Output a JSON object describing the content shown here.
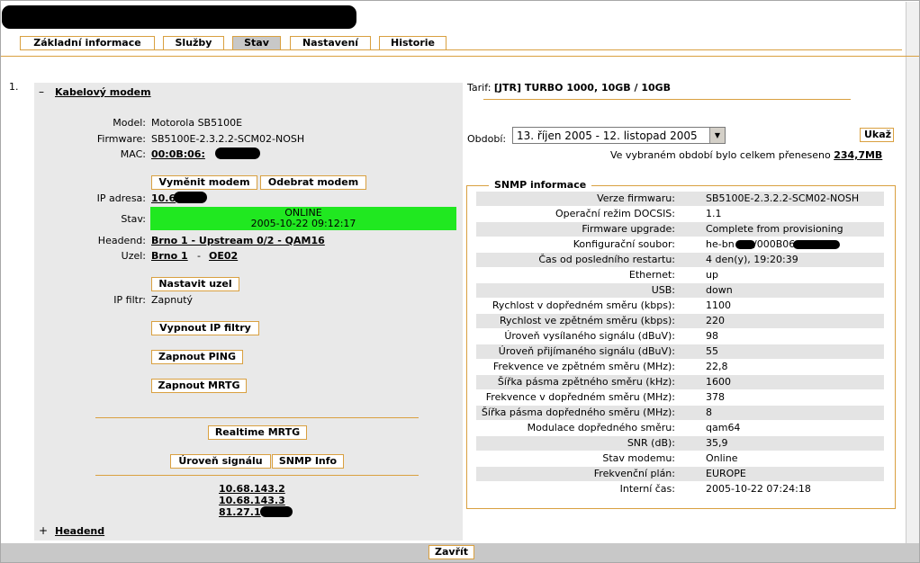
{
  "tabs": [
    {
      "label": "Základní informace"
    },
    {
      "label": "Služby"
    },
    {
      "label": "Stav"
    },
    {
      "label": "Nastavení"
    },
    {
      "label": "Historie"
    }
  ],
  "list_number": "1.",
  "modem_section": {
    "toggle": "–",
    "title": "Kabelový modem",
    "model_label": "Model:",
    "model_value": "Motorola SB5100E",
    "firmware_label": "Firmware:",
    "firmware_value": "SB5100E-2.3.2.2-SCM02-NOSH",
    "mac_label": "MAC:",
    "mac_value": "00:0B:06:",
    "replace_modem": "Vyměnit modem",
    "remove_modem": "Odebrat modem",
    "ip_label": "IP adresa:",
    "ip_value": "10.6",
    "state_label": "Stav:",
    "state_value": "ONLINE",
    "state_time": "2005-10-22 09:12:17",
    "headend_label": "Headend:",
    "headend_value": "Brno 1 - Upstream 0/2 - QAM16",
    "node_label": "Uzel:",
    "node_value": "Brno 1",
    "node_sep": "-",
    "node_code": "OE02",
    "set_node": "Nastavit uzel",
    "ipfilter_label": "IP filtr:",
    "ipfilter_value": "Zapnutý",
    "disable_ip_filters": "Vypnout IP filtry",
    "enable_ping": "Zapnout PING",
    "enable_mrtg": "Zapnout MRTG",
    "realtime_mrtg": "Realtime MRTG",
    "signal_level": "Úroveň signálu",
    "snmp_info": "SNMP Info",
    "ip_links": [
      "10.68.143.2",
      "10.68.143.3",
      "81.27.1"
    ]
  },
  "headend_section": {
    "toggle": "+",
    "title": "Headend"
  },
  "tarif": {
    "label": "Tarif:",
    "value": "[JTR] TURBO 1000, 10GB / 10GB"
  },
  "period": {
    "label": "Období:",
    "selected": "13. říjen 2005 - 12. listopad 2005",
    "show_button": "Ukaž",
    "note": "Ve vybraném období bylo celkem přeneseno",
    "total": "234,7MB"
  },
  "snmp": {
    "title": "SNMP informace",
    "rows": [
      {
        "k": "Verze firmwaru:",
        "v": "SB5100E-2.3.2.2-SCM02-NOSH"
      },
      {
        "k": "Operační režim DOCSIS:",
        "v": "1.1"
      },
      {
        "k": "Firmware upgrade:",
        "v": "Complete from provisioning"
      },
      {
        "k": "Konfigurační soubor:",
        "v": "he-bn"
      },
      {
        "k": "Čas od posledního restartu:",
        "v": "4 den(y), 19:20:39"
      },
      {
        "k": "Ethernet:",
        "v": "up"
      },
      {
        "k": "USB:",
        "v": "down"
      },
      {
        "k": "Rychlost v dopředném směru (kbps):",
        "v": "1100"
      },
      {
        "k": "Rychlost ve zpětném směru (kbps):",
        "v": "220"
      },
      {
        "k": "Úroveň vysílaného signálu (dBuV):",
        "v": "98"
      },
      {
        "k": "Úroveň přijímaného signálu (dBuV):",
        "v": "55"
      },
      {
        "k": "Frekvence ve zpětném směru (MHz):",
        "v": "22,8"
      },
      {
        "k": "Šířka pásma zpětného směru (kHz):",
        "v": "1600"
      },
      {
        "k": "Frekvence v dopředném směru (MHz):",
        "v": "378"
      },
      {
        "k": "Šířka pásma dopředného směru (MHz):",
        "v": "8"
      },
      {
        "k": "Modulace dopředného směru:",
        "v": "qam64"
      },
      {
        "k": "SNR (dB):",
        "v": "35,9"
      },
      {
        "k": "Stav modemu:",
        "v": "Online"
      },
      {
        "k": "Frekvenční plán:",
        "v": "EUROPE"
      },
      {
        "k": "Interní čas:",
        "v": "2005-10-22 07:24:18"
      }
    ],
    "config_file_suffix": "/000B06"
  },
  "close_button": "Zavřít",
  "colors": {
    "accent": "#d9a040",
    "online": "#20e820",
    "panel": "#e9e9e9",
    "active_tab": "#c8c8c8"
  }
}
